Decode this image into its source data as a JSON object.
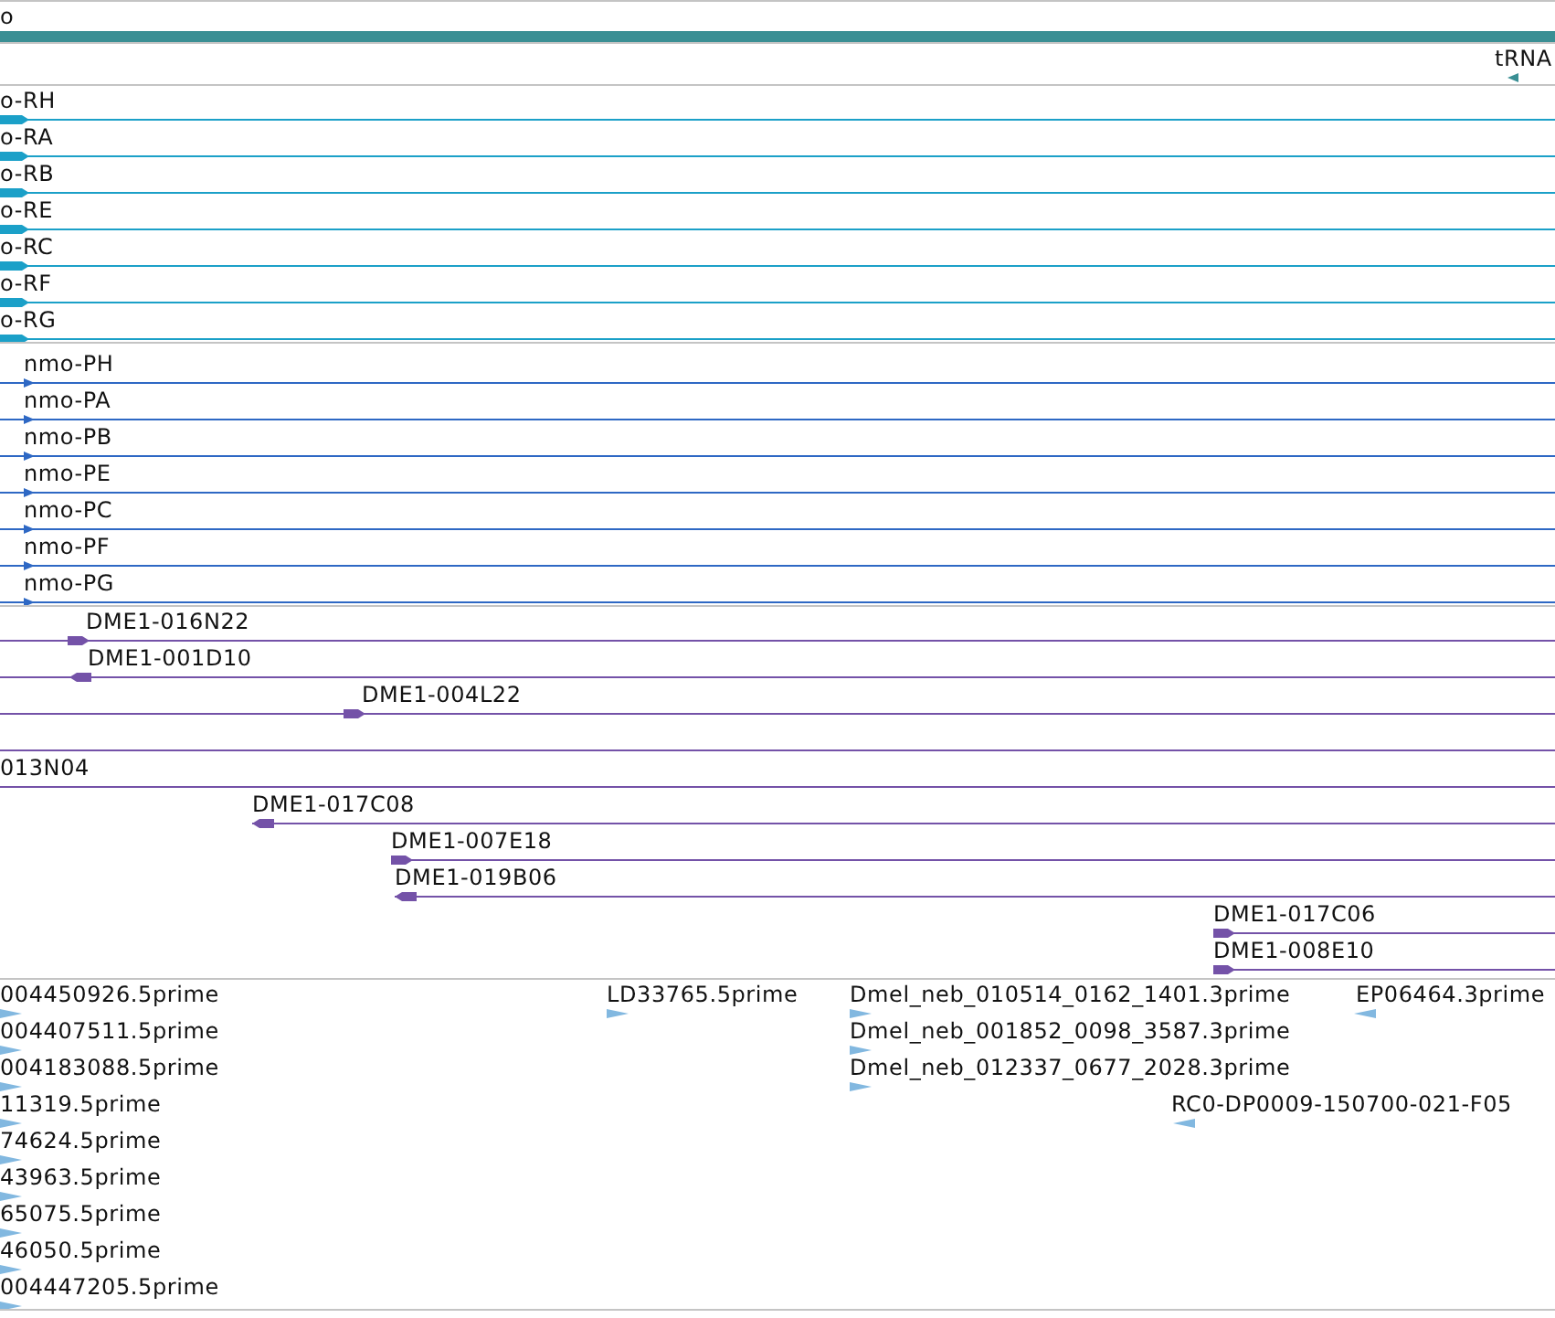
{
  "tracks": [
    {
      "kind": "scaffold",
      "rows": [
        {
          "kind": "span",
          "features": [
            {
              "label": "o"
            }
          ]
        }
      ]
    },
    {
      "kind": "trna",
      "rows": [
        {
          "kind": "none",
          "features": [
            {
              "label": "tRNA",
              "reverse": true
            }
          ]
        }
      ]
    },
    {
      "kind": "transcripts",
      "rows": [
        {
          "kind": "span",
          "features": [
            {
              "label": "o-RH",
              "reverse": false
            }
          ]
        },
        {
          "kind": "span",
          "features": [
            {
              "label": "o-RA",
              "reverse": false
            }
          ]
        },
        {
          "kind": "span",
          "features": [
            {
              "label": "o-RB",
              "reverse": false
            }
          ]
        },
        {
          "kind": "span",
          "features": [
            {
              "label": "o-RE",
              "reverse": false
            }
          ]
        },
        {
          "kind": "span",
          "features": [
            {
              "label": "o-RC",
              "reverse": false
            }
          ]
        },
        {
          "kind": "span",
          "features": [
            {
              "label": "o-RF",
              "reverse": false
            }
          ]
        },
        {
          "kind": "span",
          "features": [
            {
              "label": "o-RG",
              "reverse": false
            }
          ]
        }
      ]
    },
    {
      "kind": "proteins",
      "rows": [
        {
          "kind": "span",
          "features": [
            {
              "label": "nmo-PH",
              "reverse": false
            }
          ]
        },
        {
          "kind": "span",
          "features": [
            {
              "label": "nmo-PA",
              "reverse": false
            }
          ]
        },
        {
          "kind": "span",
          "features": [
            {
              "label": "nmo-PB",
              "reverse": false
            }
          ]
        },
        {
          "kind": "span",
          "features": [
            {
              "label": "nmo-PE",
              "reverse": false
            }
          ]
        },
        {
          "kind": "span",
          "features": [
            {
              "label": "nmo-PC",
              "reverse": false
            }
          ]
        },
        {
          "kind": "span",
          "features": [
            {
              "label": "nmo-PF",
              "reverse": false
            }
          ]
        },
        {
          "kind": "span",
          "features": [
            {
              "label": "nmo-PG",
              "reverse": false
            }
          ]
        }
      ]
    },
    {
      "kind": "clones",
      "rows": [
        {
          "kind": "span",
          "features": [
            {
              "label": "DME1-016N22",
              "reverse": false
            }
          ]
        },
        {
          "kind": "span",
          "features": [
            {
              "label": "DME1-001D10",
              "reverse": true
            }
          ]
        },
        {
          "kind": "span",
          "features": [
            {
              "label": "DME1-004L22",
              "reverse": false
            }
          ]
        },
        {
          "kind": "span"
        },
        {
          "kind": "span",
          "features": [
            {
              "label": "013N04"
            }
          ]
        },
        {
          "kind": "start",
          "features": [
            {
              "label": "DME1-017C08",
              "reverse": true
            }
          ]
        },
        {
          "kind": "start",
          "features": [
            {
              "label": "DME1-007E18",
              "reverse": false
            }
          ]
        },
        {
          "kind": "start",
          "features": [
            {
              "label": "DME1-019B06",
              "reverse": true
            }
          ]
        },
        {
          "kind": "start",
          "features": [
            {
              "label": "DME1-017C06",
              "reverse": false
            }
          ]
        },
        {
          "kind": "start",
          "features": [
            {
              "label": "DME1-008E10",
              "reverse": false
            }
          ]
        }
      ]
    },
    {
      "kind": "ests",
      "rows": [
        {
          "kind": "none",
          "features": [
            {
              "label": "004450926.5prime",
              "reverse": false
            },
            {
              "label": "LD33765.5prime",
              "reverse": false
            },
            {
              "label": "Dmel_neb_010514_0162_1401.3prime",
              "reverse": false
            },
            {
              "label": "EP06464.3prime",
              "reverse": true
            }
          ]
        },
        {
          "kind": "none",
          "features": [
            {
              "label": "004407511.5prime",
              "reverse": false
            },
            {
              "label": "Dmel_neb_001852_0098_3587.3prime",
              "reverse": false
            }
          ]
        },
        {
          "kind": "none",
          "features": [
            {
              "label": "004183088.5prime",
              "reverse": false
            },
            {
              "label": "Dmel_neb_012337_0677_2028.3prime",
              "reverse": false
            }
          ]
        },
        {
          "kind": "none",
          "features": [
            {
              "label": "11319.5prime",
              "reverse": false
            },
            {
              "label": "RC0-DP0009-150700-021-F05",
              "reverse": true
            }
          ]
        },
        {
          "kind": "none",
          "features": [
            {
              "label": "74624.5prime",
              "reverse": false
            }
          ]
        },
        {
          "kind": "none",
          "features": [
            {
              "label": "43963.5prime",
              "reverse": false
            }
          ]
        },
        {
          "kind": "none",
          "features": [
            {
              "label": "65075.5prime",
              "reverse": false
            }
          ]
        },
        {
          "kind": "none",
          "features": [
            {
              "label": "46050.5prime",
              "reverse": false
            }
          ]
        },
        {
          "kind": "none",
          "features": [
            {
              "label": "004447205.5prime",
              "reverse": false
            }
          ]
        }
      ]
    }
  ]
}
